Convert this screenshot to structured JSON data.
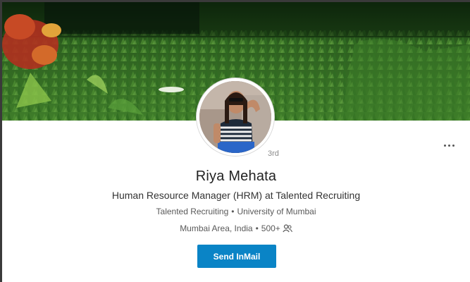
{
  "profile": {
    "name": "Riya Mehata",
    "degree": "3rd",
    "headline": "Human Resource Manager (HRM) at Talented Recruiting",
    "company": "Talented Recruiting",
    "separator": "•",
    "school": "University of Mumbai",
    "location": "Mumbai Area, India",
    "connections": "500+"
  },
  "actions": {
    "send_inmail_label": "Send InMail",
    "more_icon": "more-horizontal-icon",
    "connections_icon": "people-icon"
  },
  "colors": {
    "accent": "#0a84c6",
    "cover_green": "#2f6b22"
  }
}
